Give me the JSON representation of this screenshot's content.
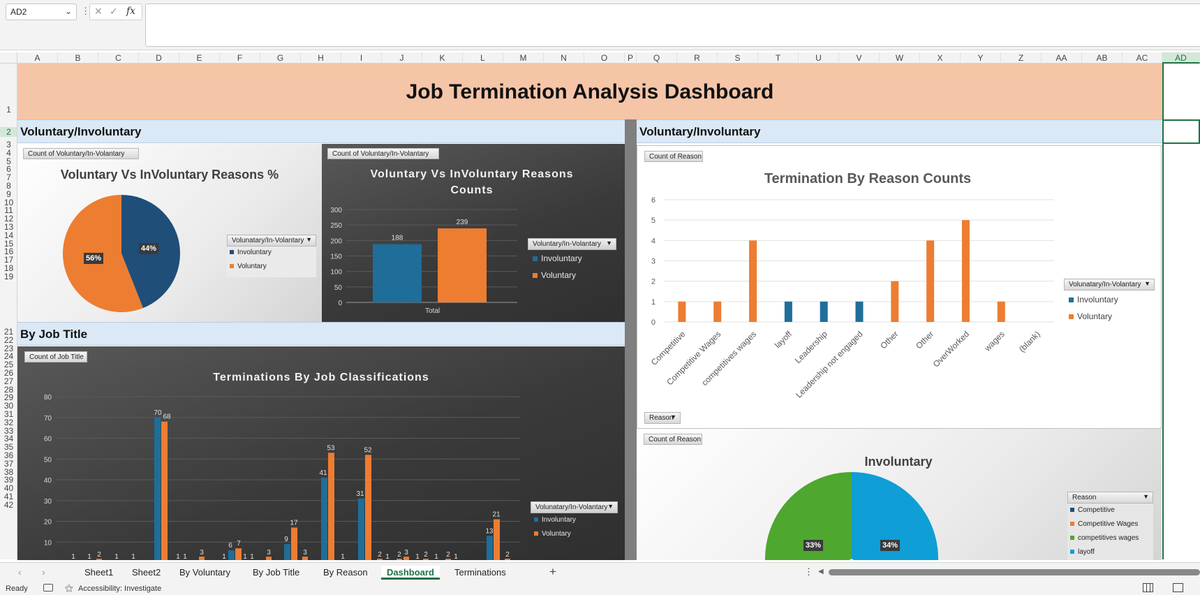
{
  "formula_bar": {
    "name_box": "AD2",
    "fx_label": "fx"
  },
  "columns": [
    "A",
    "B",
    "C",
    "D",
    "E",
    "F",
    "G",
    "H",
    "I",
    "J",
    "K",
    "L",
    "M",
    "N",
    "O",
    "P",
    "Q",
    "R",
    "S",
    "T",
    "U",
    "V",
    "W",
    "X",
    "Y",
    "Z",
    "AA",
    "AB",
    "AC",
    "AD"
  ],
  "rows": [
    "1",
    "2",
    "3",
    "4",
    "5",
    "6",
    "7",
    "8",
    "9",
    "10",
    "11",
    "12",
    "13",
    "14",
    "15",
    "16",
    "17",
    "18",
    "19",
    "21",
    "22",
    "23",
    "24",
    "25",
    "26",
    "27",
    "28",
    "29",
    "30",
    "31",
    "32",
    "33",
    "34",
    "35",
    "36",
    "37",
    "38",
    "39",
    "40",
    "41",
    "42"
  ],
  "dashboard": {
    "title": "Job Termination Analysis Dashboard",
    "section_left": "Voluntary/Involuntary",
    "section_right": "Voluntary/Involuntary",
    "section_job": "By Job Title"
  },
  "colors": {
    "involuntary": "#1f4e79",
    "voluntary": "#ed7d31",
    "green": "#4ea72e",
    "cyan": "#0f9ed5",
    "header_band": "#f5c5a8",
    "section": "#dbe8f5"
  },
  "charts": {
    "pie1": {
      "field_button": "Count of Voluntary/In-Volantary",
      "title": "Voluntary Vs InVoluntary Reasons %",
      "legend_button": "Volunatary/In-Volantary",
      "legend": [
        "Involuntary",
        "Voluntary"
      ],
      "labels": [
        "44%",
        "56%"
      ]
    },
    "bar1": {
      "field_button": "Count of Voluntary/In-Volantary",
      "title_line1": "Voluntary Vs InVoluntary Reasons",
      "title_line2": "Counts",
      "legend_button": "Voluntary/In-Volantary",
      "legend": [
        "Involuntary",
        "Voluntary"
      ],
      "x_label": "Total"
    },
    "reason": {
      "field_button": "Count of Reason",
      "title": "Termination By Reason Counts",
      "legend_button": "Volunatary/In-Volantary",
      "legend": [
        "Involuntary",
        "Voluntary"
      ],
      "axis_button": "Reason"
    },
    "job": {
      "field_button": "Count of Job Title",
      "title": "Terminations By Job Classifications",
      "legend_button": "Volunatary/In-Volantary",
      "legend": [
        "Involuntary",
        "Voluntary"
      ]
    },
    "pie2": {
      "field_button": "Count of Reason",
      "title": "Involuntary",
      "legend_button": "Reason",
      "legend": [
        "Competitive",
        "Competitive Wages",
        "competitives wages",
        "layoff"
      ],
      "labels": [
        "33%",
        "34%"
      ]
    }
  },
  "chart_data": [
    {
      "type": "pie",
      "title": "Voluntary Vs InVoluntary Reasons %",
      "categories": [
        "Involuntary",
        "Voluntary"
      ],
      "values": [
        44,
        56
      ]
    },
    {
      "type": "bar",
      "title": "Voluntary Vs InVoluntary Reasons Counts",
      "categories": [
        "Total"
      ],
      "series": [
        {
          "name": "Involuntary",
          "values": [
            188
          ]
        },
        {
          "name": "Voluntary",
          "values": [
            239
          ]
        }
      ],
      "ylim": [
        0,
        300
      ],
      "yticks": [
        0,
        50,
        100,
        150,
        200,
        250,
        300
      ]
    },
    {
      "type": "bar",
      "title": "Termination By Reason Counts",
      "categories": [
        "Competitive",
        "Competitive Wages",
        "competitives wages",
        "layoff",
        "Leadership",
        "Leadership not engaged",
        "Other",
        "Other",
        "OverWorked",
        "wages",
        "(blank)"
      ],
      "series": [
        {
          "name": "Involuntary",
          "values": [
            0,
            0,
            0,
            1,
            1,
            1,
            0,
            0,
            0,
            0,
            0
          ]
        },
        {
          "name": "Voluntary",
          "values": [
            1,
            1,
            4,
            0,
            0,
            0,
            2,
            4,
            5,
            1,
            0
          ]
        }
      ],
      "ylim": [
        0,
        6
      ],
      "yticks": [
        0,
        1,
        2,
        3,
        4,
        5,
        6
      ]
    },
    {
      "type": "bar",
      "title": "Terminations By Job Classifications",
      "ylim": [
        0,
        80
      ],
      "yticks": [
        10,
        20,
        30,
        40,
        50,
        60,
        70,
        80
      ],
      "series": [
        {
          "name": "Involuntary",
          "values": [
            null,
            null,
            null,
            70,
            null,
            null,
            6,
            9,
            41,
            31,
            null,
            null,
            null,
            null,
            null,
            13
          ]
        },
        {
          "name": "Voluntary",
          "values": [
            1,
            2,
            null,
            68,
            3,
            1,
            7,
            17,
            53,
            52,
            2,
            3,
            2,
            2,
            1,
            21,
            2
          ]
        }
      ],
      "small_labels": [
        "1",
        "1",
        "2",
        "1",
        "1",
        "1",
        "1",
        "3",
        "1",
        "1",
        "1",
        "3",
        "3",
        "1",
        "2",
        "1",
        "2",
        "3",
        "2",
        "1",
        "2",
        "1",
        "1",
        "2"
      ]
    },
    {
      "type": "pie",
      "title": "Involuntary",
      "categories": [
        "Competitive",
        "Competitive Wages",
        "competitives wages",
        "layoff"
      ],
      "values": [
        null,
        null,
        33,
        34
      ]
    }
  ],
  "sheet_tabs": [
    "Sheet1",
    "Sheet2",
    "By Voluntary",
    "By Job Title",
    "By Reason",
    "Dashboard",
    "Terminations"
  ],
  "active_tab": "Dashboard",
  "status": {
    "ready": "Ready",
    "accessibility": "Accessibility: Investigate"
  }
}
